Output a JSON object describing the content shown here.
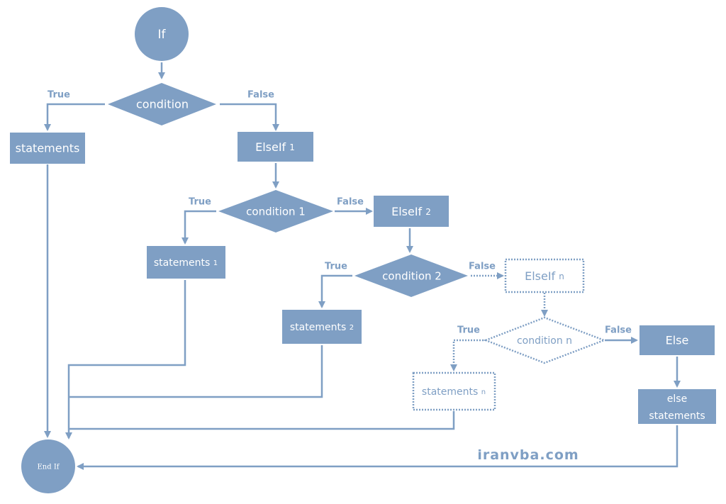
{
  "nodes": {
    "if": "If",
    "condition": "condition",
    "statements": "statements",
    "elseif1": {
      "text": "ElseIf",
      "sub": "1"
    },
    "condition1": "condition 1",
    "statements1": {
      "text": "statements",
      "sub": "1"
    },
    "elseif2": {
      "text": "ElseIf",
      "sub": "2"
    },
    "condition2": "condition 2",
    "statements2": {
      "text": "statements",
      "sub": "2"
    },
    "elseifn": {
      "text": "ElseIf",
      "sub": "n"
    },
    "conditionn": "condition n",
    "statementsn": {
      "text": "statements",
      "sub": "n"
    },
    "else": "Else",
    "else_statements": [
      "else",
      "statements"
    ],
    "endif": "End If"
  },
  "labels": {
    "true": "True",
    "false": "False"
  },
  "watermark": "iranvba.com",
  "colors": {
    "shape": "#7f9fc4",
    "background": "#ffffff"
  }
}
